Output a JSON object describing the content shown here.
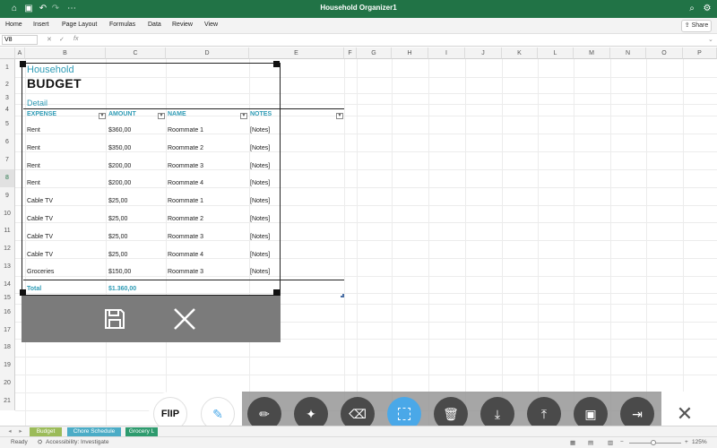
{
  "window": {
    "title": "Household Organizer1"
  },
  "ribbon": {
    "tabs": [
      "Home",
      "Insert",
      "Page Layout",
      "Formulas",
      "Data",
      "Review",
      "View"
    ],
    "share_label": "Share"
  },
  "formula_bar": {
    "name_box": "V8",
    "fx": "fx"
  },
  "columns": [
    "A",
    "B",
    "C",
    "D",
    "E",
    "F",
    "G",
    "H",
    "I",
    "J",
    "K",
    "L",
    "M",
    "N",
    "O",
    "P"
  ],
  "rows": [
    "1",
    "2",
    "3",
    "4",
    "5",
    "6",
    "7",
    "8",
    "9",
    "10",
    "11",
    "12",
    "13",
    "14",
    "15",
    "16",
    "17",
    "18",
    "19",
    "20",
    "21"
  ],
  "sheet": {
    "title_line1": "Household",
    "title_line2": "BUDGET",
    "section": "Detail",
    "headers": {
      "expense": "EXPENSE",
      "amount": "AMOUNT",
      "name": "NAME",
      "notes": "NOTES"
    },
    "rows": [
      {
        "expense": "Rent",
        "amount": "$360,00",
        "name": "Roommate 1",
        "notes": "[Notes]"
      },
      {
        "expense": "Rent",
        "amount": "$350,00",
        "name": "Roommate 2",
        "notes": "[Notes]"
      },
      {
        "expense": "Rent",
        "amount": "$200,00",
        "name": "Roommate 3",
        "notes": "[Notes]"
      },
      {
        "expense": "Rent",
        "amount": "$200,00",
        "name": "Roommate 4",
        "notes": "[Notes]"
      },
      {
        "expense": "Cable TV",
        "amount": "$25,00",
        "name": "Roommate 1",
        "notes": "[Notes]"
      },
      {
        "expense": "Cable TV",
        "amount": "$25,00",
        "name": "Roommate 2",
        "notes": "[Notes]"
      },
      {
        "expense": "Cable TV",
        "amount": "$25,00",
        "name": "Roommate 3",
        "notes": "[Notes]"
      },
      {
        "expense": "Cable TV",
        "amount": "$25,00",
        "name": "Roommate 4",
        "notes": "[Notes]"
      },
      {
        "expense": "Groceries",
        "amount": "$150,00",
        "name": "Roommate 3",
        "notes": "[Notes]"
      }
    ],
    "total_label": "Total",
    "total_amount": "$1.360,00"
  },
  "flip_label": "FlIP",
  "sheet_tabs": [
    "Budget",
    "Chore Schedule",
    "Grocery L"
  ],
  "status": {
    "ready": "Ready",
    "accessibility": "Accessibility: Investigate",
    "zoom": "125%"
  },
  "colors": {
    "excel_green": "#217346",
    "accent_teal": "#2e9bb5",
    "active_tool": "#4aa8e8"
  }
}
